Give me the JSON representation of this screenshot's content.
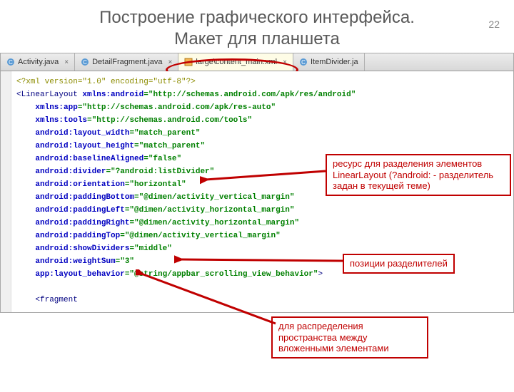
{
  "pageNumber": "22",
  "title_line1": "Построение графического интерфейса.",
  "title_line2": "Макет для планшета",
  "tabs": {
    "t0": "Activity.java",
    "t1": "DetailFragment.java",
    "t2": "large\\content_main.xml",
    "t3": "ItemDivider.ja"
  },
  "code": {
    "l1": "<?xml version=\"1.0\" encoding=\"utf-8\"?>",
    "l2a": "<LinearLayout ",
    "l2b": "xmlns:android",
    "l2c": "=\"http://schemas.android.com/apk/res/android\"",
    "l3a": "xmlns:app",
    "l3b": "=\"http://schemas.android.com/apk/res-auto\"",
    "l4a": "xmlns:tools",
    "l4b": "=\"http://schemas.android.com/tools\"",
    "l5a": "android:layout_width",
    "l5b": "=\"match_parent\"",
    "l6a": "android:layout_height",
    "l6b": "=\"match_parent\"",
    "l7a": "android:baselineAligned",
    "l7b": "=\"false\"",
    "l8a": "android:divider",
    "l8b": "=\"?android:listDivider\"",
    "l9a": "android:orientation",
    "l9b": "=\"horizontal\"",
    "l10a": "android:paddingBottom",
    "l10b": "=\"@dimen/activity_vertical_margin\"",
    "l11a": "android:paddingLeft",
    "l11b": "=\"@dimen/activity_horizontal_margin\"",
    "l12a": "android:paddingRight",
    "l12b": "=\"@dimen/activity_horizontal_margin\"",
    "l13a": "android:paddingTop",
    "l13b": "=\"@dimen/activity_vertical_margin\"",
    "l14a": "android:showDividers",
    "l14b": "=\"middle\"",
    "l15a": "android:weightSum",
    "l15b": "=\"3\"",
    "l16a": "app:layout_behavior",
    "l16b": "=\"@string/appbar_scrolling_view_behavior\"",
    "l16c": ">",
    "l17": "<fragment"
  },
  "callouts": {
    "c1": "ресурс для разделения элементов LinearLayout (?android: - разделитель задан в текущей теме)",
    "c2": "позиции разделителей",
    "c3": "для распределения пространства между вложенными элементами"
  }
}
